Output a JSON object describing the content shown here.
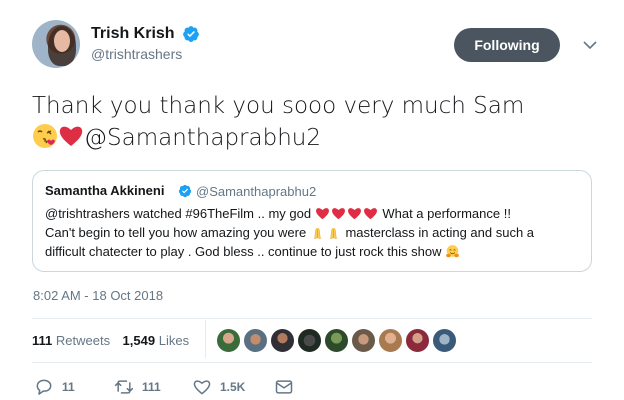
{
  "author": {
    "name": "Trish Krish",
    "handle": "@trishtrashers"
  },
  "follow_button": "Following",
  "tweet": {
    "text": "Thank you thank you sooo very much Sam",
    "mention": "@Samanthaprabhu2"
  },
  "quoted": {
    "name": "Samantha Akkineni",
    "handle": "@Samanthaprabhu2",
    "mention": "@trishtrashers",
    "text1": "watched #96TheFilm .. my god",
    "text2": "What a performance !!",
    "text3": "Can't begin to tell you how amazing you were",
    "text4": "masterclass in acting and such a",
    "text5": "difficult chatecter to play . God bless .. continue to just rock this show"
  },
  "timestamp": "8:02 AM - 18 Oct 2018",
  "stats": {
    "retweets_count": "111",
    "retweets_label": "Retweets",
    "likes_count": "1,549",
    "likes_label": "Likes"
  },
  "actions": {
    "reply": "11",
    "retweet": "111",
    "like": "1.5K"
  },
  "colors": {
    "verified": "#1da1f2",
    "follow_button_bg": "#4a5560",
    "muted": "#657786",
    "heart": "#e0245e"
  }
}
